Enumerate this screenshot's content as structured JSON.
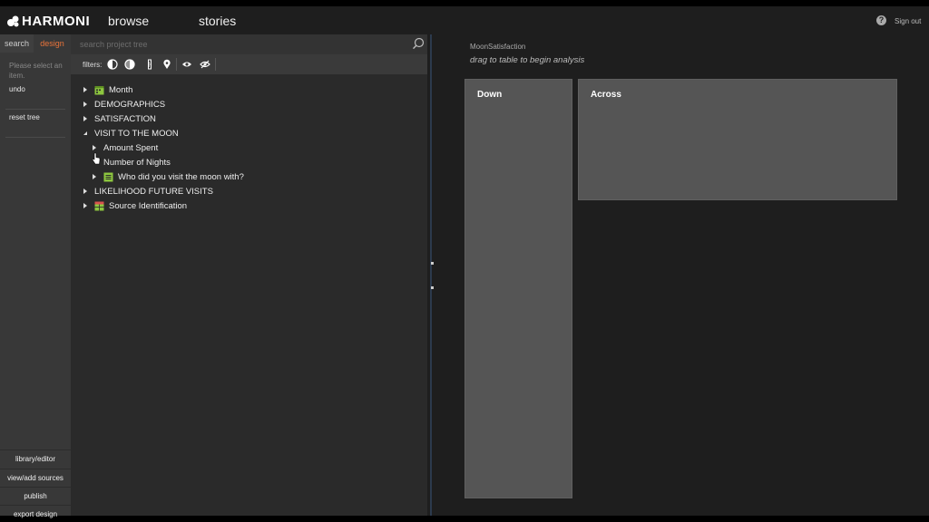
{
  "header": {
    "logo_text": "HARMONI",
    "nav": {
      "browse": "browse",
      "stories": "stories"
    },
    "help_glyph": "?",
    "signout": "Sign out"
  },
  "left": {
    "tabs": {
      "search": "search",
      "design": "design"
    },
    "select_hint": "Please select an item.",
    "undo": "undo",
    "reset_tree": "reset tree",
    "bottom": [
      "library/editor",
      "view/add sources",
      "publish",
      "export design"
    ]
  },
  "tree": {
    "search_placeholder": "search project tree",
    "filters_label": "filters:",
    "items": [
      {
        "label": "Month",
        "caret": "collapsed",
        "icon": "calendar-icon"
      },
      {
        "label": "DEMOGRAPHICS",
        "caret": "collapsed"
      },
      {
        "label": "SATISFACTION",
        "caret": "collapsed"
      },
      {
        "label": "VISIT TO THE MOON",
        "caret": "expanded"
      },
      {
        "label": "Amount Spent",
        "caret": "collapsed"
      },
      {
        "label": "Number of Nights",
        "caret": "none"
      },
      {
        "label": "Who did you visit the moon with?",
        "caret": "collapsed",
        "icon": "list-icon"
      },
      {
        "label": "LIKELIHOOD FUTURE VISITS",
        "caret": "collapsed"
      },
      {
        "label": "Source Identification",
        "caret": "collapsed",
        "icon": "table-icon"
      }
    ]
  },
  "analysis": {
    "name": "MoonSatisfaction",
    "hint": "drag to table to begin analysis",
    "down_label": "Down",
    "across_label": "Across"
  },
  "colors": {
    "accent": "#e8733a",
    "icon_green": "#8dc63f"
  }
}
